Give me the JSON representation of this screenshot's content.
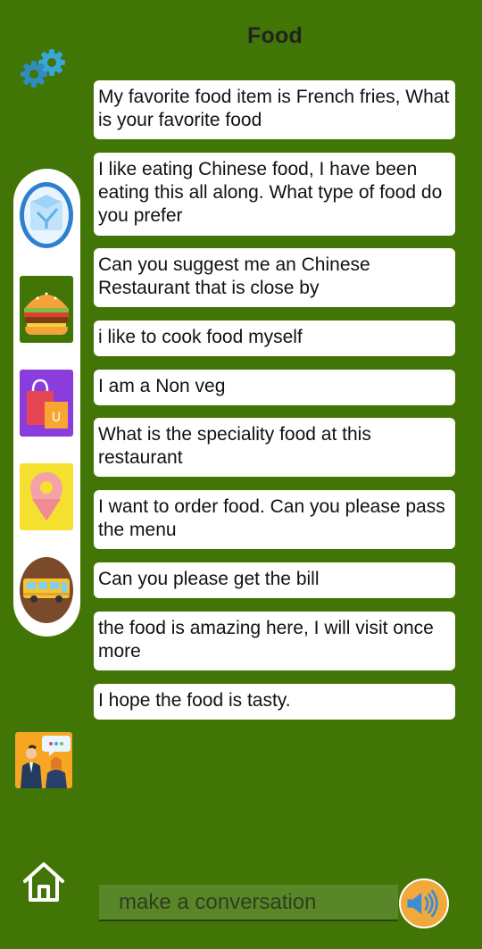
{
  "header": {
    "title": "Food"
  },
  "phrases": [
    "My favorite food item is French fries, What is your favorite food",
    "I like eating Chinese food, I have been eating this all along. What type of food do you prefer",
    "Can you suggest me an Chinese Restaurant that is close by",
    "i like to cook food myself",
    "I am a Non veg",
    "What is the speciality food at this restaurant",
    "I want to order food. Can you please pass the menu",
    "Can you please get the bill",
    "the food is amazing here, I will visit once more",
    "I hope the food is tasty."
  ],
  "sidebar": {
    "items": [
      {
        "icon": "ice-cube-icon"
      },
      {
        "icon": "burger-icon"
      },
      {
        "icon": "shopping-bag-icon"
      },
      {
        "icon": "map-pin-icon"
      },
      {
        "icon": "bus-icon"
      }
    ]
  },
  "input": {
    "placeholder": "make a conversation",
    "value": ""
  },
  "icons": {
    "settings": "gears-icon",
    "conversation": "conversation-people-icon",
    "home": "home-icon",
    "speak": "speaker-icon"
  },
  "colors": {
    "background": "#417505",
    "card": "#ffffff",
    "accent": "#f2a93b"
  }
}
